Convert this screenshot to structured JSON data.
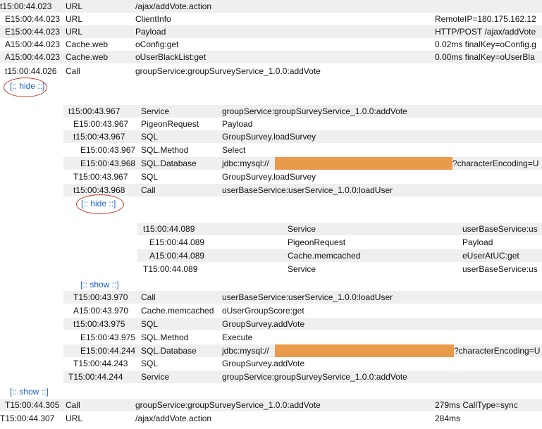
{
  "colors": {
    "shade": "#efefef",
    "link": "#1a5fc9",
    "redaction": "#e99a4a",
    "annotation_circle": "#c0392b"
  },
  "outer": {
    "rows_top": [
      {
        "time": "t15:00:44.023",
        "type": "URL",
        "name": "/ajax/addVote.action",
        "data": ""
      },
      {
        "time": "E15:00:44.023",
        "type": "URL",
        "name": "ClientInfo",
        "data": "RemoteIP=180.175.162.12"
      },
      {
        "time": "E15:00:44.023",
        "type": "URL",
        "name": "Payload",
        "data": "HTTP/POST /ajax/addVote"
      },
      {
        "time": "A15:00:44.023",
        "type": "Cache.web",
        "name": "oConfig:get",
        "data": "0.02ms finalKey=oConfig.g"
      },
      {
        "time": "A15:00:44.023",
        "type": "Cache.web",
        "name": "oUserBlackList:get",
        "data": "0.00ms finalKey=oUserBla"
      },
      {
        "time": "t15:00:44.026",
        "type": "Call",
        "name": "groupService:groupSurveyService_1.0.0:addVote",
        "data": ""
      }
    ],
    "hide_label": "[:: hide ::]",
    "show_label": "[:: show ::]",
    "rows_bottom": [
      {
        "time": "T15:00:44.305",
        "type": "Call",
        "name": "groupService:groupSurveyService_1.0.0:addVote",
        "data": "279ms CallType=sync"
      },
      {
        "time": "T15:00:44.307",
        "type": "URL",
        "name": "/ajax/addVote.action",
        "data": "284ms"
      }
    ]
  },
  "level2": {
    "rows_top": [
      {
        "time": "t15:00:43.967",
        "type": "Service",
        "name": "groupService:groupSurveyService_1.0.0:addVote"
      },
      {
        "time": "E15:00:43.967",
        "type": "PigeonRequest",
        "name": "Payload"
      },
      {
        "time": "t15:00:43.967",
        "type": "SQL",
        "name": "GroupSurvey.loadSurvey"
      },
      {
        "time": "E15:00:43.967",
        "type": "SQL.Method",
        "name": "Select"
      },
      {
        "time": "E15:00:43.968",
        "type": "SQL.Database",
        "name": "jdbc:mysql://",
        "suffix": "?characterEncoding=U"
      },
      {
        "time": "T15:00:43.967",
        "type": "SQL",
        "name": "GroupSurvey.loadSurvey"
      },
      {
        "time": "t15:00:43.968",
        "type": "Call",
        "name": "userBaseService:userService_1.0.0:loadUser"
      }
    ],
    "hide_label": "[:: hide ::]",
    "show_label": "[:: show ::]",
    "rows_bottom": [
      {
        "time": "T15:00:43.970",
        "type": "Call",
        "name": "userBaseService:userService_1.0.0:loadUser"
      },
      {
        "time": "A15:00:43.970",
        "type": "Cache.memcached",
        "name": "oUserGroupScore:get"
      },
      {
        "time": "t15:00:43.975",
        "type": "SQL",
        "name": "GroupSurvey.addVote"
      },
      {
        "time": "E15:00:43.975",
        "type": "SQL.Method",
        "name": "Execute"
      },
      {
        "time": "E15:00:44.244",
        "type": "SQL.Database",
        "name": "jdbc:mysql://",
        "suffix": "?characterEncoding=U"
      },
      {
        "time": "T15:00:44.243",
        "type": "SQL",
        "name": "GroupSurvey.addVote"
      },
      {
        "time": "T15:00:44.244",
        "type": "Service",
        "name": "groupService:groupSurveyService_1.0.0:addVote"
      }
    ]
  },
  "level3": {
    "rows": [
      {
        "time": "t15:00:44.089",
        "type": "Service",
        "name": "userBaseService:us"
      },
      {
        "time": "E15:00:44.089",
        "type": "PigeonRequest",
        "name": "Payload"
      },
      {
        "time": "A15:00:44.089",
        "type": "Cache.memcached",
        "name": "eUserAtUC:get"
      },
      {
        "time": "T15:00:44.089",
        "type": "Service",
        "name": "userBaseService:us"
      }
    ]
  }
}
